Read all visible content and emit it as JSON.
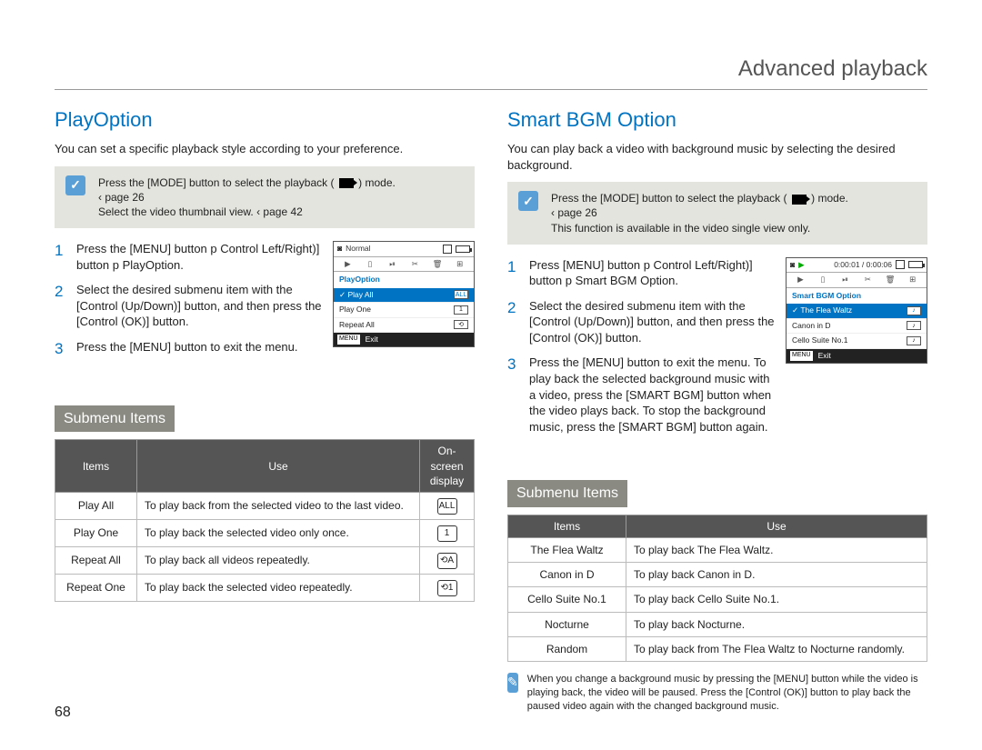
{
  "header": {
    "title": "Advanced playback"
  },
  "page_number": "68",
  "left": {
    "heading": "PlayOption",
    "intro": "You can set a specific playback style according to your preference.",
    "note_line1_a": "Press the [MODE] button to select the playback (",
    "note_line1_b": ") mode.",
    "note_line2": "‹ page 26",
    "note_line3": "Select the video thumbnail view. ‹ page 42",
    "steps": [
      "Press the [MENU] button p Control Left/Right)] button p PlayOption.",
      "Select the desired submenu item with the [Control (Up/Down)] button, and then press the [Control (OK)] button.",
      "Press the [MENU] button to exit the menu."
    ],
    "lcd": {
      "top_label": "Normal",
      "title": "PlayOption",
      "rows": [
        "Play All",
        "Play One",
        "Repeat All"
      ],
      "selected_index": 0,
      "exit": "Exit",
      "menu_key": "MENU"
    },
    "submenu_heading": "Submenu Items",
    "table": {
      "headers": [
        "Items",
        "Use",
        "On-screen display"
      ],
      "rows": [
        {
          "item": "Play All",
          "use": "To play back from the selected video to the last video.",
          "icon": "ALL"
        },
        {
          "item": "Play One",
          "use": "To play back the selected video only once.",
          "icon": "1"
        },
        {
          "item": "Repeat All",
          "use": "To play back all videos repeatedly.",
          "icon": "⟲A"
        },
        {
          "item": "Repeat One",
          "use": "To play back the selected video repeatedly.",
          "icon": "⟲1"
        }
      ]
    }
  },
  "right": {
    "heading": "Smart BGM Option",
    "intro": "You can play back a video with background music by selecting the desired background.",
    "note_line1_a": "Press the [MODE] button to select the playback (",
    "note_line1_b": ") mode.",
    "note_line2": "‹ page 26",
    "note_line3": "This function is available in the video single view only.",
    "steps": [
      "Press [MENU] button p Control Left/Right)] button p Smart BGM Option.",
      "Select the desired submenu item with the [Control (Up/Down)] button, and then press the [Control (OK)] button.",
      "Press the [MENU] button to exit the menu. To play back the selected background music with a video, press the [SMART BGM] button when the video plays back. To stop the background music, press the [SMART BGM] button again."
    ],
    "lcd": {
      "top_label": "0:00:01 / 0:00:06",
      "title": "Smart BGM Option",
      "rows": [
        "The Flea Waltz",
        "Canon in D",
        "Cello Suite No.1"
      ],
      "selected_index": 0,
      "exit": "Exit",
      "menu_key": "MENU"
    },
    "submenu_heading": "Submenu Items",
    "table": {
      "headers": [
        "Items",
        "Use"
      ],
      "rows": [
        {
          "item": "The Flea Waltz",
          "use": "To play back The Flea Waltz."
        },
        {
          "item": "Canon in D",
          "use": "To play back Canon in D."
        },
        {
          "item": "Cello Suite No.1",
          "use": "To play back Cello Suite No.1."
        },
        {
          "item": "Nocturne",
          "use": "To play back Nocturne."
        },
        {
          "item": "Random",
          "use": "To play back from The Flea Waltz to Nocturne randomly."
        }
      ]
    },
    "footnote": "When you change a background music by pressing the [MENU] button while the video is playing back, the video will be paused. Press the [Control (OK)] button to play back the paused video again with the changed background music."
  }
}
